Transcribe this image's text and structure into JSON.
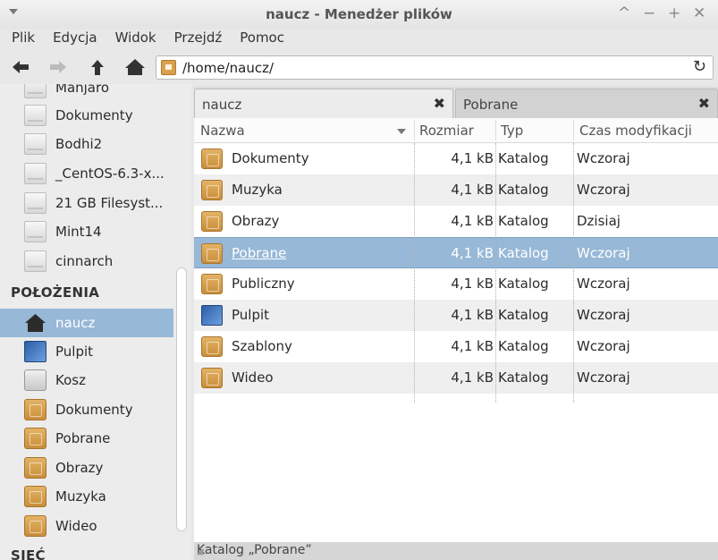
{
  "window": {
    "title": "naucz - Menedżer plików",
    "controls": [
      "^",
      "−",
      "+",
      "✕"
    ]
  },
  "menu": [
    "Plik",
    "Edycja",
    "Widok",
    "Przejdź",
    "Pomoc"
  ],
  "toolbar": {
    "path": "/home/naucz/",
    "buttons": [
      "back-arrow-icon",
      "forward-arrow-icon",
      "up-arrow-icon",
      "home-icon"
    ],
    "refresh_icon": "↻"
  },
  "sidebar": {
    "devices": [
      {
        "label": "Manjaro",
        "icon": "drive-icon"
      },
      {
        "label": "Dokumenty",
        "icon": "drive-icon"
      },
      {
        "label": "Bodhi2",
        "icon": "drive-icon"
      },
      {
        "label": "_CentOS-6.3-x...",
        "icon": "drive-icon"
      },
      {
        "label": "21 GB Filesyst...",
        "icon": "drive-icon"
      },
      {
        "label": "Mint14",
        "icon": "drive-icon"
      },
      {
        "label": "cinnarch",
        "icon": "drive-icon"
      }
    ],
    "places_heading": "POŁOŻENIA",
    "places": [
      {
        "label": "naucz",
        "icon": "home-icon",
        "selected": true
      },
      {
        "label": "Pulpit",
        "icon": "desktop-icon"
      },
      {
        "label": "Kosz",
        "icon": "trash-icon"
      },
      {
        "label": "Dokumenty",
        "icon": "documents-folder-icon"
      },
      {
        "label": "Pobrane",
        "icon": "downloads-folder-icon"
      },
      {
        "label": "Obrazy",
        "icon": "pictures-folder-icon"
      },
      {
        "label": "Muzyka",
        "icon": "music-folder-icon"
      },
      {
        "label": "Wideo",
        "icon": "videos-folder-icon"
      }
    ],
    "network_heading": "SIEĆ"
  },
  "tabs": [
    {
      "label": "naucz",
      "close": "✖",
      "active": true
    },
    {
      "label": "Pobrane",
      "close": "✖",
      "active": false
    }
  ],
  "columns": {
    "name": "Nazwa",
    "size": "Rozmiar",
    "type": "Typ",
    "modified": "Czas modyfikacji"
  },
  "files": [
    {
      "name": "Dokumenty",
      "size": "4,1 kB",
      "type": "Katalog",
      "modified": "Wczoraj",
      "icon": "documents-folder-icon",
      "glyph": "▯"
    },
    {
      "name": "Muzyka",
      "size": "4,1 kB",
      "type": "Katalog",
      "modified": "Wczoraj",
      "icon": "music-folder-icon",
      "glyph": "♫"
    },
    {
      "name": "Obrazy",
      "size": "4,1 kB",
      "type": "Katalog",
      "modified": "Dzisiaj",
      "icon": "pictures-folder-icon",
      "glyph": "▣"
    },
    {
      "name": "Pobrane",
      "size": "4,1 kB",
      "type": "Katalog",
      "modified": "Wczoraj",
      "icon": "downloads-folder-icon",
      "glyph": "⇩",
      "selected": true
    },
    {
      "name": "Publiczny",
      "size": "4,1 kB",
      "type": "Katalog",
      "modified": "Wczoraj",
      "icon": "public-folder-icon",
      "glyph": "<"
    },
    {
      "name": "Pulpit",
      "size": "4,1 kB",
      "type": "Katalog",
      "modified": "Wczoraj",
      "icon": "desktop-icon",
      "glyph": ""
    },
    {
      "name": "Szablony",
      "size": "4,1 kB",
      "type": "Katalog",
      "modified": "Wczoraj",
      "icon": "templates-folder-icon",
      "glyph": "♙"
    },
    {
      "name": "Wideo",
      "size": "4,1 kB",
      "type": "Katalog",
      "modified": "Wczoraj",
      "icon": "videos-folder-icon",
      "glyph": "●"
    }
  ],
  "status": "Katalog „Pobrane”"
}
